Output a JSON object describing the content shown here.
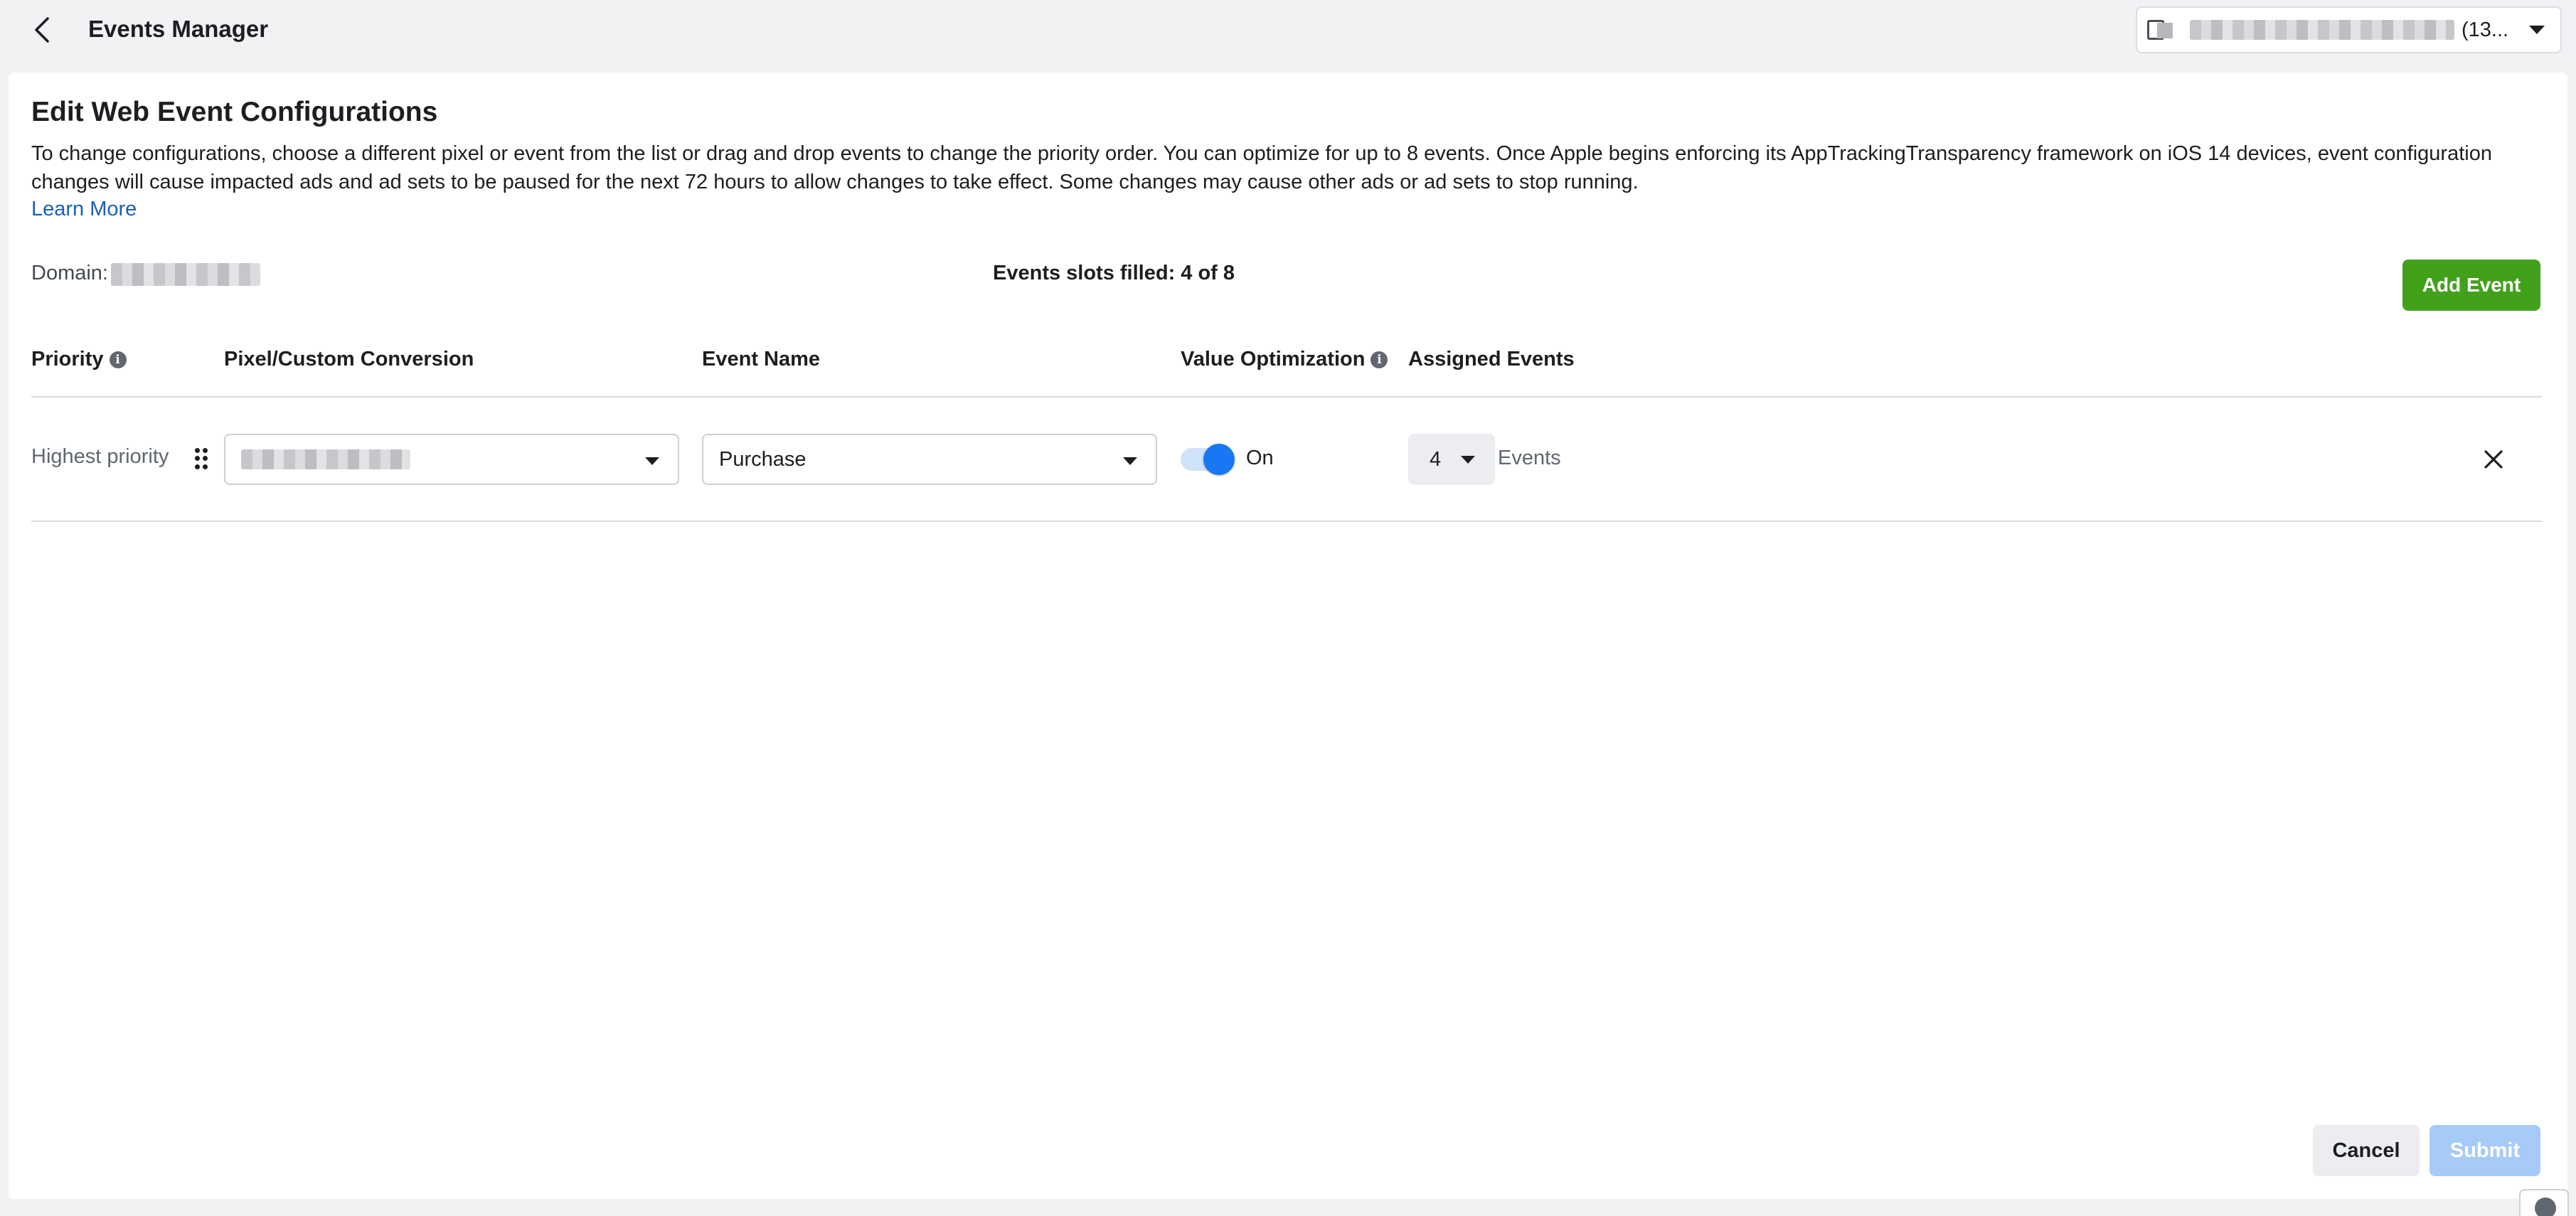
{
  "header": {
    "title": "Events Manager",
    "account_id_fragment": "(13..."
  },
  "page": {
    "title": "Edit Web Event Configurations",
    "description": "To change configurations, choose a different pixel or event from the list or drag and drop events to change the priority order. You can optimize for up to 8 events. Once Apple begins enforcing its AppTrackingTransparency framework on iOS 14 devices, event configuration changes will cause impacted ads and ad sets to be paused for the next 72 hours to allow changes to take effect. Some changes may cause other ads or ad sets to stop running.",
    "learn_more": "Learn More",
    "domain_label": "Domain:",
    "slots_text": "Events slots filled: 4 of 8",
    "add_event": "Add Event"
  },
  "table": {
    "headers": {
      "priority": "Priority",
      "pixel": "Pixel/Custom Conversion",
      "event_name": "Event Name",
      "value_optimization": "Value Optimization",
      "assigned_events": "Assigned Events"
    },
    "rows": [
      {
        "priority": "Highest priority",
        "event_name": "Purchase",
        "value_optimization_state": "On",
        "value_optimization_enabled": true,
        "assigned_count": "4",
        "assigned_suffix": "Events"
      }
    ]
  },
  "footer": {
    "cancel": "Cancel",
    "submit": "Submit"
  },
  "colors": {
    "accent_blue": "#1877f2",
    "add_button_green": "#42a11b",
    "submit_disabled": "#a7cbf7",
    "link": "#1b5fb8"
  }
}
